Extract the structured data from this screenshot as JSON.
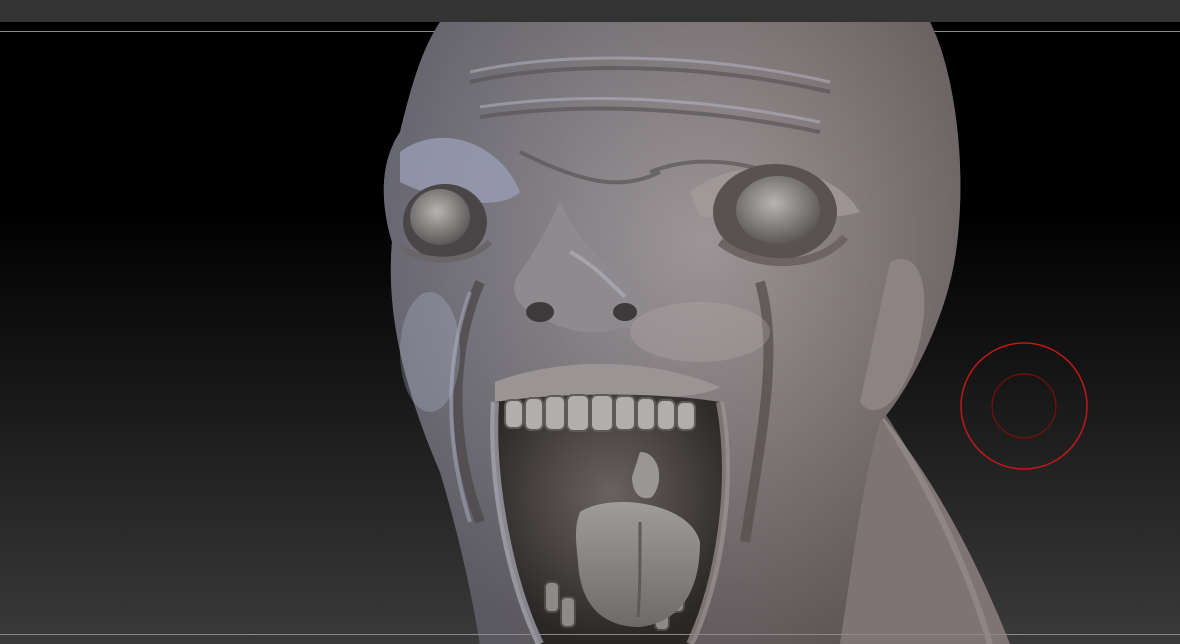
{
  "app": {
    "window": "sculpting-viewport"
  },
  "viewport": {
    "background_top": "#000000",
    "background_bottom": "#3a3a3a",
    "frame_line_color": "#8a8a8a"
  },
  "model": {
    "subject": "screaming-creature-head",
    "material_color": "#8c8584",
    "highlight_color": "#a9b0c8",
    "warm_tint": "#9a8080"
  },
  "brush_cursor": {
    "icon": "brush-cursor-icon",
    "color": "#c01818"
  }
}
